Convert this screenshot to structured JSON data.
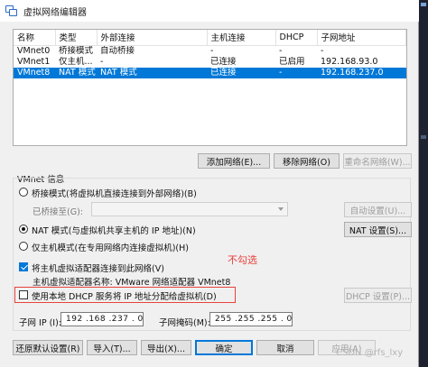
{
  "window": {
    "title": "虚拟网络编辑器"
  },
  "network_list": {
    "columns": [
      "名称",
      "类型",
      "外部连接",
      "主机连接",
      "DHCP",
      "子网地址"
    ],
    "rows": [
      {
        "name": "VMnet0",
        "type": "桥接模式",
        "external": "自动桥接",
        "host": "-",
        "dhcp": "-",
        "subnet": "-"
      },
      {
        "name": "VMnet1",
        "type": "仅主机...",
        "external": "-",
        "host": "已连接",
        "dhcp": "已启用",
        "subnet": "192.168.93.0"
      },
      {
        "name": "VMnet8",
        "type": "NAT 模式",
        "external": "NAT 模式",
        "host": "已连接",
        "dhcp": "-",
        "subnet": "192.168.237.0",
        "selected": true
      }
    ]
  },
  "list_buttons": {
    "add": "添加网络(E)...",
    "remove": "移除网络(O)",
    "rename": "重命名网络(W)..."
  },
  "vmnet_info": {
    "title": "VMnet 信息",
    "bridged_label": "桥接模式(将虚拟机直接连接到外部网络)(B)",
    "bridged_to_label": "已桥接至(G):",
    "bridged_to_value": "",
    "auto_settings": "自动设置(U)...",
    "nat_label": "NAT 模式(与虚拟机共享主机的 IP 地址)(N)",
    "nat_settings": "NAT 设置(S)...",
    "hostonly_label": "仅主机模式(在专用网络内连接虚拟机)(H)",
    "mode_selected": "nat",
    "connect_adapter_label": "将主机虚拟适配器连接到此网络(V)",
    "connect_adapter_checked": true,
    "adapter_name_label": "主机虚拟适配器名称: VMware 网络适配器 VMnet8",
    "dhcp_label": "使用本地 DHCP 服务将 IP 地址分配给虚拟机(D)",
    "dhcp_checked": false,
    "dhcp_settings": "DHCP 设置(P)...",
    "subnet_ip_label": "子网 IP (I):",
    "subnet_ip_value": "192 .168 .237 . 0",
    "subnet_mask_label": "子网掩码(M):",
    "subnet_mask_value": "255 .255 .255 . 0"
  },
  "annotation": {
    "text": "不勾选",
    "color": "#e8413c"
  },
  "footer_buttons": {
    "restore": "还原默认设置(R)",
    "import": "导入(T)...",
    "export": "导出(X)...",
    "ok": "确定",
    "cancel": "取消",
    "apply": "应用(A)"
  },
  "watermark": "CSDN @rfs_lxy",
  "colors": {
    "selection": "#0078d7",
    "annotation": "#e8413c"
  }
}
